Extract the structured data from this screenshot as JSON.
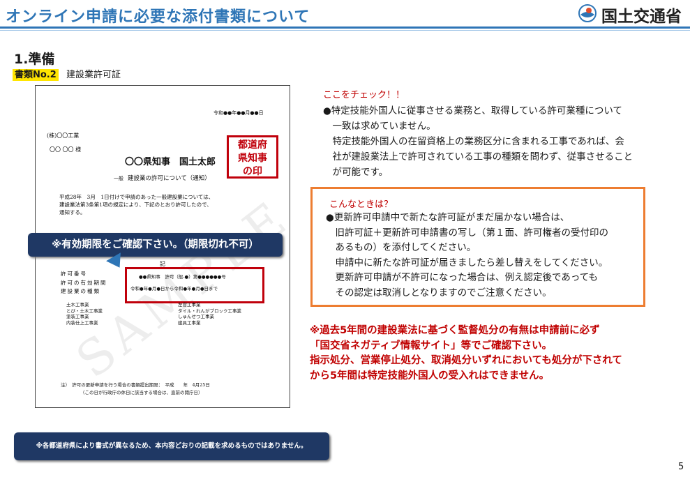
{
  "header": {
    "title": "オンライン申請に必要な添付書類について",
    "logo_text": "国土交通省",
    "accent_color": "#2e75b6"
  },
  "section": {
    "title": "1.準備",
    "doc_tag": "書類No.2",
    "doc_name": "建設業許可証"
  },
  "sample_document": {
    "date": "令和●●年●●月●●日",
    "company": "(株)〇〇工業",
    "addressee": "〇〇 〇〇 様",
    "issuer": "〇〇県知事　国土太郎",
    "stamp_lines": [
      "都道府",
      "県知事",
      "の印"
    ],
    "notice_prefix": "一般",
    "notice_title": "建設業の許可について（通知）",
    "body_lines": [
      "平成28年　3月　1日付けで申請のあった一般建設業については、",
      "建設業法第3条第1項の規定により、下記のとおり許可したので、",
      "通知する。"
    ],
    "ki": "記",
    "field_labels": [
      "許可番号",
      "許可の有効期間",
      "建設業の種類"
    ],
    "permit_number": "●●県知事　許可（般-●）第●●●●●●号",
    "validity": "令和●年●月●日から令和●年●月●日まで",
    "trades_left": [
      "土木工事業",
      "とび・土木工事業",
      "塗装工事業",
      "内装仕上工事業"
    ],
    "trades_right": [
      "左官工事業",
      "タイル・れんがブロック工事業",
      "しゅんせつ工事業",
      "建具工事業"
    ],
    "footer_lines": [
      "注）　許可の更新申請を行う場合の書類提出期限：　平成　　年　4月25日",
      "（この日が行政庁の休日に該当する場合は、直前の開庁日）"
    ],
    "watermark": "SAMPLE"
  },
  "callout": "※有効期限をご確認下さい。（期限切れ不可）",
  "check": {
    "title": "ここをチェック！！",
    "lines": [
      "●特定技能外国人に従事させる業務と、取得している許可業種について",
      "　一致は求めていません。",
      "　特定技能外国人の在留資格上の業務区分に含まれる工事であれば、会",
      "　社が建設業法上で許可されている工事の種類を問わず、従事させること",
      "　が可能です。"
    ]
  },
  "case": {
    "title": "こんなときは？",
    "lines": [
      "●更新許可申請中で新たな許可証がまだ届かない場合は、",
      "　旧許可証＋更新許可申請書の写し（第１面、許可権者の受付印の",
      "　あるもの）を添付してください。",
      "　申請中に新たな許可証が届きましたら差し替えをしてください。",
      "　更新許可申請が不許可になった場合は、例え認定後であっても",
      "　その認定は取消しとなりますのでご注意ください。"
    ]
  },
  "warning": {
    "lines": [
      "※過去5年間の建設業法に基づく監督処分の有無は申請前に必ず",
      "「国交省ネガティブ情報サイト」等でご確認下さい。",
      "指示処分、営業停止処分、取消処分いずれにおいても処分が下されて",
      "から5年間は特定技能外国人の受入れはできません。"
    ]
  },
  "bottom_note": "※各都道府県により書式が異なるため、本内容どおりの記載を求めるものではありません。",
  "page_number": "5"
}
